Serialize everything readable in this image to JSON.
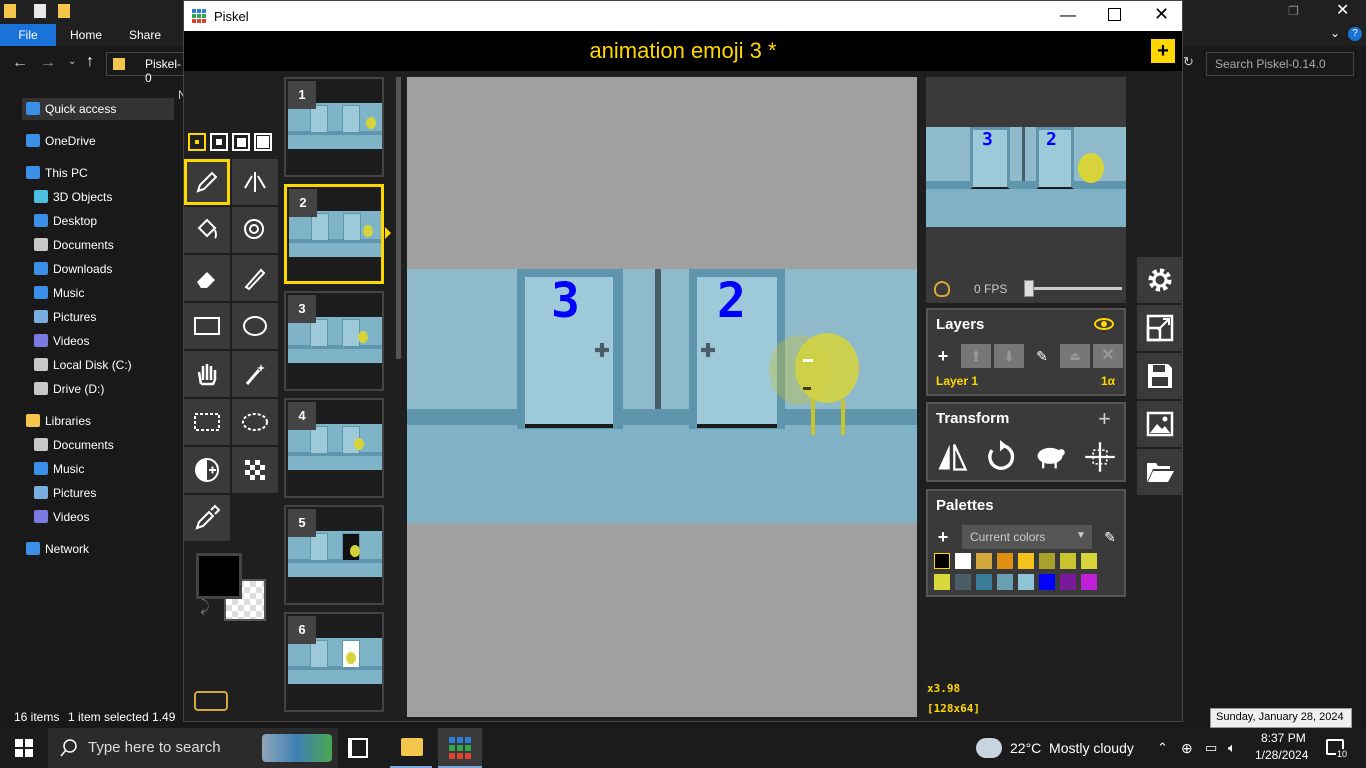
{
  "explorer": {
    "ribbon": {
      "file": "File",
      "home": "Home",
      "share": "Share"
    },
    "address": "Piskel-0",
    "search_placeholder": "Search Piskel-0.14.0",
    "nav": [
      {
        "label": "Quick access",
        "icon": "star-icon"
      },
      {
        "label": "OneDrive",
        "icon": "cloud-icon"
      },
      {
        "label": "This PC",
        "icon": "computer-icon"
      },
      {
        "label": "3D Objects",
        "icon": "cube-icon"
      },
      {
        "label": "Desktop",
        "icon": "desktop-icon"
      },
      {
        "label": "Documents",
        "icon": "document-icon"
      },
      {
        "label": "Downloads",
        "icon": "download-icon"
      },
      {
        "label": "Music",
        "icon": "music-icon"
      },
      {
        "label": "Pictures",
        "icon": "picture-icon"
      },
      {
        "label": "Videos",
        "icon": "video-icon"
      },
      {
        "label": "Local Disk (C:)",
        "icon": "disk-icon"
      },
      {
        "label": "Drive (D:)",
        "icon": "drive-icon"
      },
      {
        "label": "Libraries",
        "icon": "library-icon"
      },
      {
        "label": "Documents",
        "icon": "document-icon"
      },
      {
        "label": "Music",
        "icon": "music-icon"
      },
      {
        "label": "Pictures",
        "icon": "picture-icon"
      },
      {
        "label": "Videos",
        "icon": "video-icon"
      },
      {
        "label": "Network",
        "icon": "network-icon"
      }
    ],
    "status": {
      "items": "16 items",
      "selected": "1 item selected  1.49"
    }
  },
  "piskel": {
    "window_title": "Piskel",
    "doc_title": "animation emoji 3 *",
    "pen_sizes": [
      "1",
      "2",
      "3",
      "4"
    ],
    "frames": [
      {
        "num": "1"
      },
      {
        "num": "2"
      },
      {
        "num": "3"
      },
      {
        "num": "4"
      },
      {
        "num": "5"
      },
      {
        "num": "6"
      }
    ],
    "preview": {
      "fps": "0 FPS"
    },
    "layers": {
      "title": "Layers",
      "layer_name": "Layer 1",
      "opacity": "1α"
    },
    "transform": {
      "title": "Transform"
    },
    "palettes": {
      "title": "Palettes",
      "current": "Current colors",
      "colors": [
        "#000000",
        "#ffffff",
        "#d4a83a",
        "#e08e10",
        "#f5c21b",
        "#a8a22a",
        "#c8c430",
        "#d6d43a",
        "#d8d83c",
        "#4b5d68",
        "#3a7d98",
        "#6a9eb2",
        "#8ec4d4",
        "#0000ff",
        "#7a1a9a",
        "#c020d8"
      ]
    },
    "zoom": "x3.98",
    "size": "[128x64]",
    "canvas_digits": {
      "left": "3",
      "right": "2"
    }
  },
  "taskbar": {
    "search_placeholder": "Type here to search",
    "weather": "22°C  Mostly cloudy",
    "time": "8:37 PM",
    "date": "1/28/2024",
    "tooltip": "Sunday, January 28, 2024",
    "notifications": "10"
  }
}
